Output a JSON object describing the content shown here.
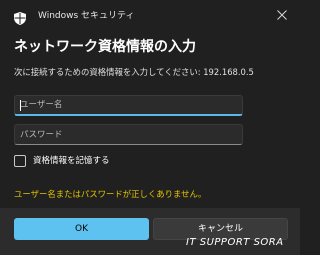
{
  "window": {
    "app_title": "Windows セキュリティ",
    "icon": "shield-icon",
    "close_icon": "close-icon"
  },
  "dialog": {
    "heading": "ネットワーク資格情報の入力",
    "prompt": "次に接続するための資格情報を入力してください: 192.168.0.5",
    "username_placeholder": "ユーザー名",
    "password_placeholder": "パスワード",
    "remember_label": "資格情報を記憶する",
    "remember_checked": false,
    "error_message": "ユーザー名またはパスワードが正しくありません。",
    "ok_label": "OK",
    "cancel_label": "キャンセル"
  },
  "watermark": "IT SUPPORT SORA",
  "colors": {
    "background": "#202020",
    "footer": "#2c2c2c",
    "accent": "#5ec2f0",
    "error": "#e3c400"
  }
}
